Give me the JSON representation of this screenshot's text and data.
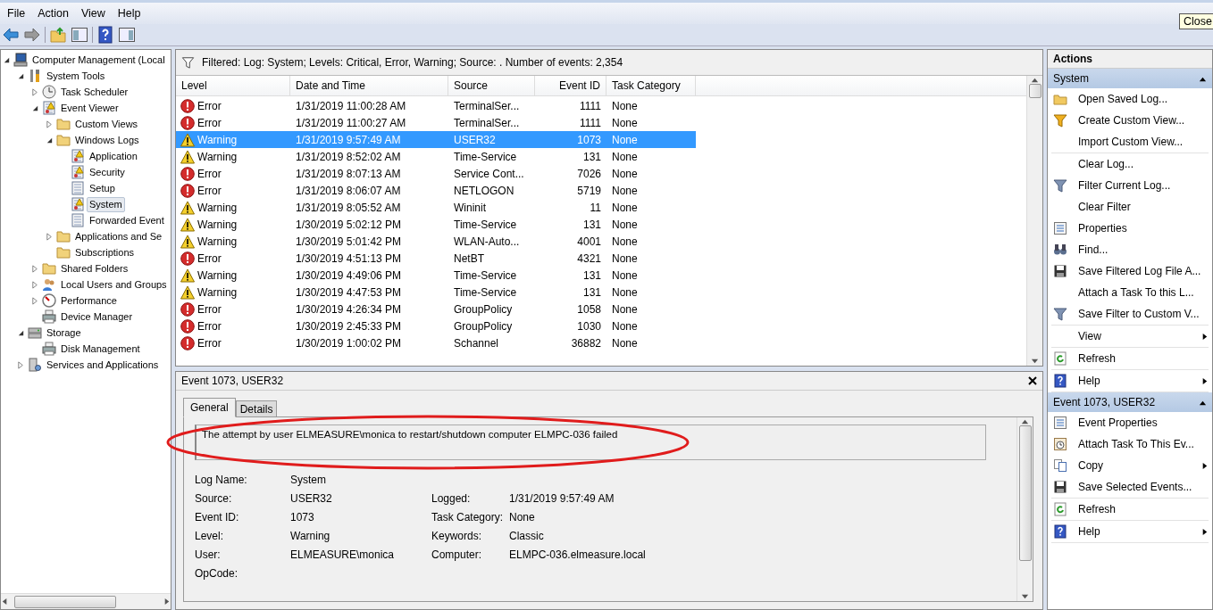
{
  "menu": [
    "File",
    "Action",
    "View",
    "Help"
  ],
  "tooltip": "Close",
  "tree": [
    {
      "label": "Computer Management (Local",
      "kind": "computer",
      "selected": false,
      "expanded": true,
      "children": [
        {
          "label": "System Tools",
          "kind": "tools",
          "selected": false,
          "expanded": true,
          "children": [
            {
              "label": "Task Scheduler",
              "kind": "clock",
              "selected": false,
              "expanded": false
            },
            {
              "label": "Event Viewer",
              "kind": "log-warning",
              "selected": false,
              "expanded": true,
              "children": [
                {
                  "label": "Custom Views",
                  "kind": "folder",
                  "selected": false,
                  "expanded": false
                },
                {
                  "label": "Windows Logs",
                  "kind": "folder",
                  "selected": false,
                  "expanded": true,
                  "children": [
                    {
                      "label": "Application",
                      "kind": "log-warning",
                      "selected": false
                    },
                    {
                      "label": "Security",
                      "kind": "log-warning",
                      "selected": false
                    },
                    {
                      "label": "Setup",
                      "kind": "log",
                      "selected": false
                    },
                    {
                      "label": "System",
                      "kind": "log-warning",
                      "selected": true
                    },
                    {
                      "label": "Forwarded Event",
                      "kind": "log",
                      "selected": false
                    }
                  ]
                },
                {
                  "label": "Applications and Se",
                  "kind": "folder",
                  "selected": false,
                  "expanded": false
                },
                {
                  "label": "Subscriptions",
                  "kind": "folder",
                  "selected": false
                }
              ]
            },
            {
              "label": "Shared Folders",
              "kind": "folder",
              "selected": false,
              "expanded": false
            },
            {
              "label": "Local Users and Groups",
              "kind": "users",
              "selected": false,
              "expanded": false
            },
            {
              "label": "Performance",
              "kind": "gauge",
              "selected": false,
              "expanded": false
            },
            {
              "label": "Device Manager",
              "kind": "printer",
              "selected": false
            }
          ]
        },
        {
          "label": "Storage",
          "kind": "storage",
          "selected": false,
          "expanded": true,
          "children": [
            {
              "label": "Disk Management",
              "kind": "printer",
              "selected": false
            }
          ]
        },
        {
          "label": "Services and Applications",
          "kind": "server",
          "selected": false,
          "expanded": false
        }
      ]
    }
  ],
  "filter": "Filtered: Log: System; Levels: Critical, Error, Warning; Source: . Number of events: 2,354",
  "columns": [
    "Level",
    "Date and Time",
    "Source",
    "Event ID",
    "Task Category"
  ],
  "rows": [
    {
      "kind": "error",
      "level": "Error",
      "date": "1/31/2019 11:00:28 AM",
      "source": "TerminalSer...",
      "id": "1111",
      "category": "None",
      "selected": false
    },
    {
      "kind": "error",
      "level": "Error",
      "date": "1/31/2019 11:00:27 AM",
      "source": "TerminalSer...",
      "id": "1111",
      "category": "None",
      "selected": false
    },
    {
      "kind": "warning",
      "level": "Warning",
      "date": "1/31/2019 9:57:49 AM",
      "source": "USER32",
      "id": "1073",
      "category": "None",
      "selected": true
    },
    {
      "kind": "warning",
      "level": "Warning",
      "date": "1/31/2019 8:52:02 AM",
      "source": "Time-Service",
      "id": "131",
      "category": "None",
      "selected": false
    },
    {
      "kind": "error",
      "level": "Error",
      "date": "1/31/2019 8:07:13 AM",
      "source": "Service Cont...",
      "id": "7026",
      "category": "None",
      "selected": false
    },
    {
      "kind": "error",
      "level": "Error",
      "date": "1/31/2019 8:06:07 AM",
      "source": "NETLOGON",
      "id": "5719",
      "category": "None",
      "selected": false
    },
    {
      "kind": "warning",
      "level": "Warning",
      "date": "1/31/2019 8:05:52 AM",
      "source": "Wininit",
      "id": "11",
      "category": "None",
      "selected": false
    },
    {
      "kind": "warning",
      "level": "Warning",
      "date": "1/30/2019 5:02:12 PM",
      "source": "Time-Service",
      "id": "131",
      "category": "None",
      "selected": false
    },
    {
      "kind": "warning",
      "level": "Warning",
      "date": "1/30/2019 5:01:42 PM",
      "source": "WLAN-Auto...",
      "id": "4001",
      "category": "None",
      "selected": false
    },
    {
      "kind": "error",
      "level": "Error",
      "date": "1/30/2019 4:51:13 PM",
      "source": "NetBT",
      "id": "4321",
      "category": "None",
      "selected": false
    },
    {
      "kind": "warning",
      "level": "Warning",
      "date": "1/30/2019 4:49:06 PM",
      "source": "Time-Service",
      "id": "131",
      "category": "None",
      "selected": false
    },
    {
      "kind": "warning",
      "level": "Warning",
      "date": "1/30/2019 4:47:53 PM",
      "source": "Time-Service",
      "id": "131",
      "category": "None",
      "selected": false
    },
    {
      "kind": "error",
      "level": "Error",
      "date": "1/30/2019 4:26:34 PM",
      "source": "GroupPolicy",
      "id": "1058",
      "category": "None",
      "selected": false
    },
    {
      "kind": "error",
      "level": "Error",
      "date": "1/30/2019 2:45:33 PM",
      "source": "GroupPolicy",
      "id": "1030",
      "category": "None",
      "selected": false
    },
    {
      "kind": "error",
      "level": "Error",
      "date": "1/30/2019 1:00:02 PM",
      "source": "Schannel",
      "id": "36882",
      "category": "None",
      "selected": false
    }
  ],
  "detail": {
    "title": "Event 1073, USER32",
    "tabs": [
      {
        "label": "General",
        "selected": true
      },
      {
        "label": "Details",
        "selected": false
      }
    ],
    "message": "The attempt by user ELMEASURE\\monica to restart/shutdown computer ELMPC-036 failed",
    "fields": [
      {
        "label": "Log Name:",
        "value": "System"
      },
      {
        "label": "Source:",
        "value": "USER32",
        "label2": "Logged:",
        "value2": "1/31/2019 9:57:49 AM"
      },
      {
        "label": "Event ID:",
        "value": "1073",
        "label2": "Task Category:",
        "value2": "None"
      },
      {
        "label": "Level:",
        "value": "Warning",
        "label2": "Keywords:",
        "value2": "Classic"
      },
      {
        "label": "User:",
        "value": "ELMEASURE\\monica",
        "label2": "Computer:",
        "value2": "ELMPC-036.elmeasure.local"
      },
      {
        "label": "OpCode:"
      }
    ]
  },
  "actions": {
    "title": "Actions",
    "sections": [
      {
        "title": "System",
        "expanded": true,
        "groups": [
          [
            {
              "label": "Open Saved Log...",
              "kind": "folder",
              "submenu": false
            },
            {
              "label": "Create Custom View...",
              "kind": "funnel-gold",
              "submenu": false
            },
            {
              "label": "Import Custom View...",
              "submenu": false
            }
          ],
          [
            {
              "label": "Clear Log...",
              "submenu": false
            },
            {
              "label": "Filter Current Log...",
              "kind": "funnel",
              "submenu": false
            },
            {
              "label": "Clear Filter",
              "submenu": false
            },
            {
              "label": "Properties",
              "kind": "sheet",
              "submenu": false
            },
            {
              "label": "Find...",
              "kind": "binoculars",
              "submenu": false
            },
            {
              "label": "Save Filtered Log File A...",
              "kind": "disk",
              "submenu": false
            },
            {
              "label": "Attach a Task To this L...",
              "submenu": false
            },
            {
              "label": "Save Filter to Custom V...",
              "kind": "funnel",
              "submenu": false
            }
          ],
          [
            {
              "label": "View",
              "submenu": true
            }
          ],
          [
            {
              "label": "Refresh",
              "kind": "refresh",
              "submenu": false
            }
          ],
          [
            {
              "label": "Help",
              "kind": "help",
              "submenu": true
            }
          ]
        ]
      },
      {
        "title": "Event 1073, USER32",
        "expanded": true,
        "groups": [
          [
            {
              "label": "Event Properties",
              "kind": "sheet",
              "submenu": false
            },
            {
              "label": "Attach Task To This Ev...",
              "kind": "clock",
              "submenu": false
            },
            {
              "label": "Copy",
              "kind": "copy",
              "submenu": true
            },
            {
              "label": "Save Selected Events...",
              "kind": "disk",
              "submenu": false
            }
          ],
          [
            {
              "label": "Refresh",
              "kind": "refresh",
              "submenu": false
            }
          ],
          [
            {
              "label": "Help",
              "kind": "help",
              "submenu": true
            }
          ]
        ]
      }
    ]
  }
}
